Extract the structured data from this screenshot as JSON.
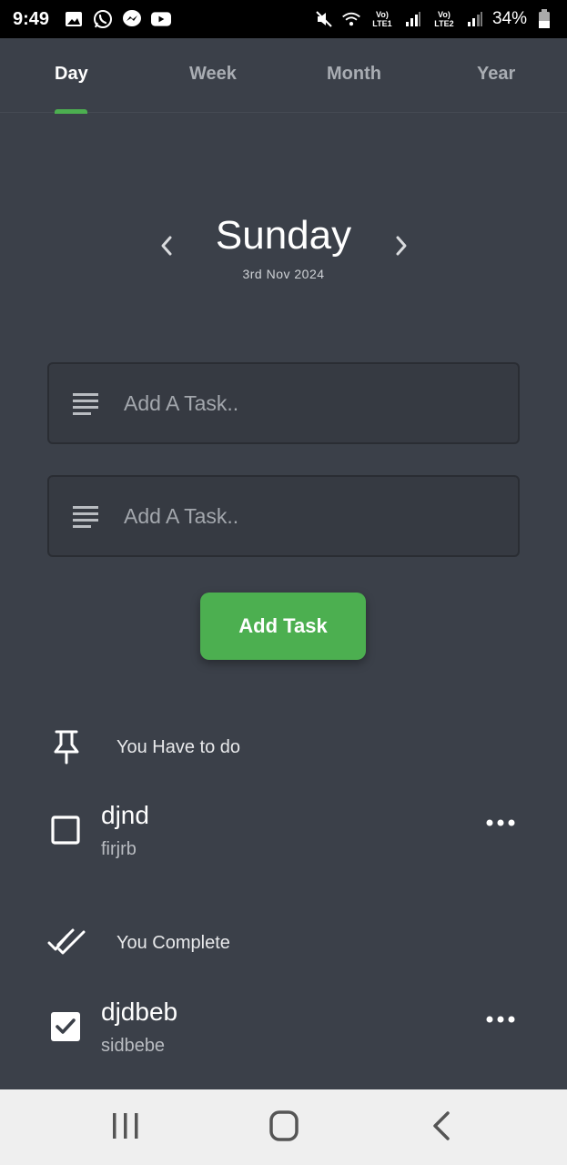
{
  "status_bar": {
    "time": "9:49",
    "notification_icons": [
      "gallery-icon",
      "whatsapp-icon",
      "messenger-icon",
      "youtube-icon"
    ],
    "sim1_label": "Vo) LTE1",
    "sim2_label": "Vo) LTE2",
    "battery": "34%"
  },
  "tabs": [
    {
      "label": "Day",
      "active": true
    },
    {
      "label": "Week",
      "active": false
    },
    {
      "label": "Month",
      "active": false
    },
    {
      "label": "Year",
      "active": false
    }
  ],
  "accent_color": "#4caf50",
  "date_header": {
    "day": "Sunday",
    "date": "3rd Nov 2024"
  },
  "inputs": [
    {
      "placeholder": "Add A Task..",
      "value": ""
    },
    {
      "placeholder": "Add A Task..",
      "value": ""
    }
  ],
  "add_button_label": "Add Task",
  "todo_section": {
    "label": "You Have to do",
    "icon": "pin-icon",
    "tasks": [
      {
        "title": "djnd",
        "subtitle": "firjrb",
        "checked": false
      }
    ]
  },
  "complete_section": {
    "label": "You Complete",
    "icon": "double-check-icon",
    "tasks": [
      {
        "title": "djdbeb",
        "subtitle": "sidbebe",
        "checked": true
      }
    ]
  }
}
